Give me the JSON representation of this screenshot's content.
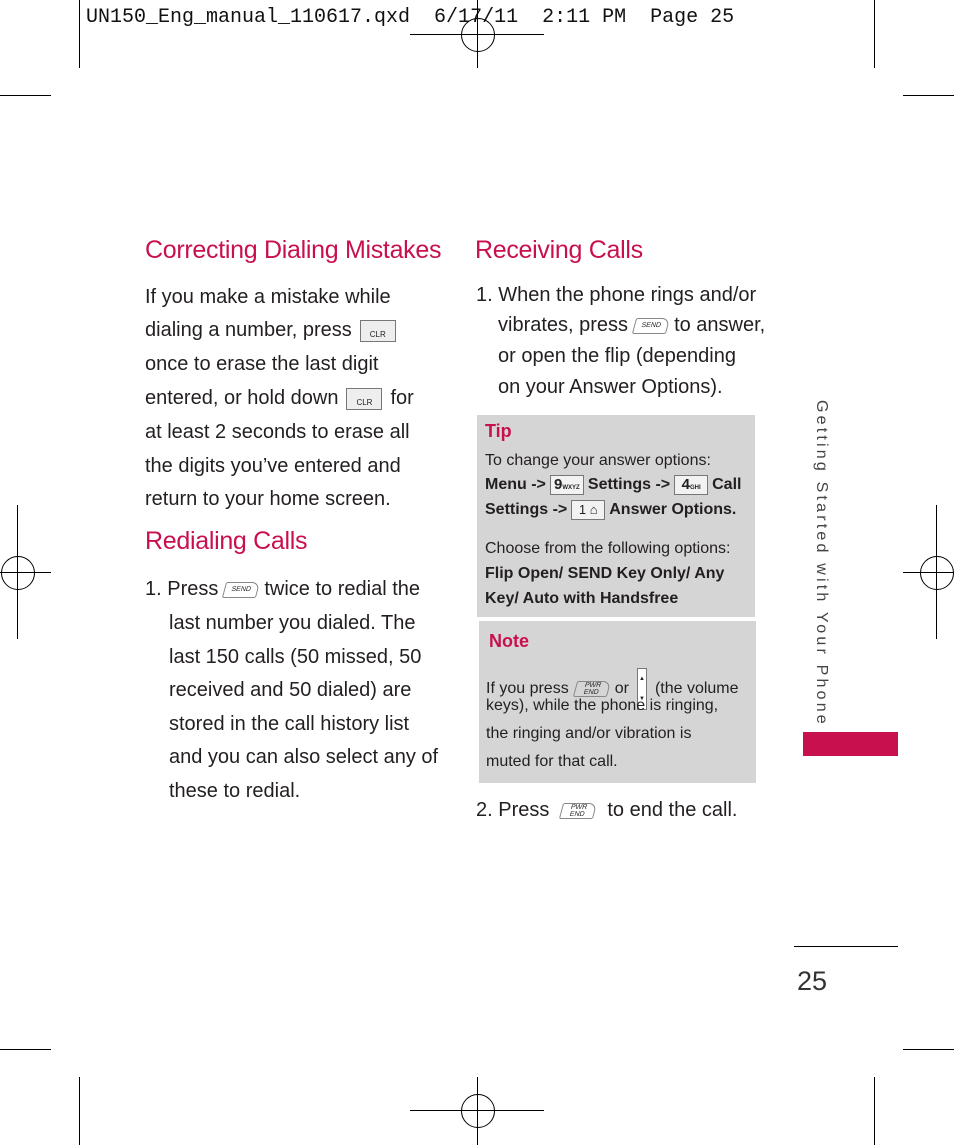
{
  "header": {
    "slug": "UN150_Eng_manual_110617.qxd  6/17/11  2:11 PM  Page 25"
  },
  "correcting": {
    "title": "Correcting Dialing Mistakes",
    "l0": "If you make a mistake while",
    "l1": "dialing a number, press",
    "l2": "once to erase the last digit",
    "l3a": "entered, or hold down",
    "l3b": "for",
    "l4": "at least 2 seconds to erase all",
    "l5": "the digits you’ve entered and",
    "l6": "return to your home screen.",
    "key": "CLR"
  },
  "redialing": {
    "title": "Redialing Calls",
    "l0a": "1. Press",
    "l0b": "twice to redial the",
    "l1": "last number you dialed. The",
    "l2": "last 150 calls (50 missed, 50",
    "l3": "received and 50 dialed) are",
    "l4": "stored in the call history list",
    "l5": "and you can also select any of",
    "l6": "these to redial.",
    "key": "SEND"
  },
  "receiving": {
    "title": "Receiving Calls",
    "l0": "1. When the phone rings and/or",
    "l1a": "vibrates, press",
    "l1b": "to answer,",
    "l2": "or open the flip (depending",
    "l3": "on your Answer Options).",
    "s2a": "2. Press",
    "s2b": "to end the call.",
    "send_key": "SEND",
    "end_key": "END",
    "end_key_top": "PWR"
  },
  "tip": {
    "label": "Tip",
    "l0": "To change your answer options:",
    "menu": "Menu ->",
    "key9": "9",
    "key9sub": "WXYZ",
    "settings": "Settings ->",
    "key4": "4",
    "key4sub": "GHI",
    "call": "Call",
    "settings2": "Settings ->",
    "key1": "1",
    "answer": "Answer Options.",
    "l3": "Choose from the following options:",
    "l4": "Flip Open/ SEND Key Only/ Any",
    "l5": "Key/ Auto with Handsfree"
  },
  "note": {
    "label": "Note",
    "l0a": "If you press",
    "l0b": "or",
    "l0c": "(the volume",
    "l1": "keys), while the phone is ringing,",
    "l2": "the ringing and/or vibration is",
    "l3": "muted for that call."
  },
  "side": {
    "tab": "Getting Started with Your Phone",
    "accent": "#c8104e"
  },
  "page_number": "25"
}
